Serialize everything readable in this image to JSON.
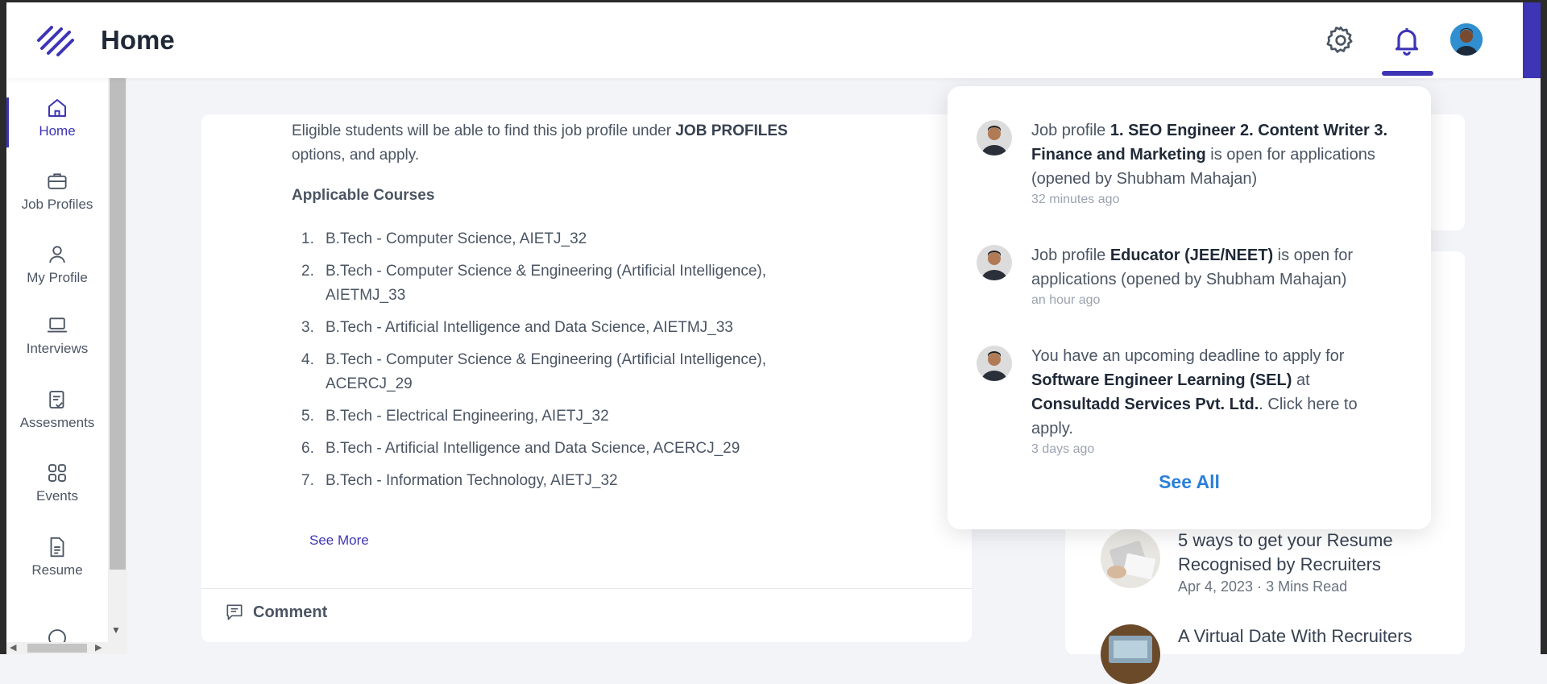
{
  "header": {
    "title": "Home",
    "icons": [
      "logo-icon",
      "gear-icon",
      "bell-icon",
      "avatar"
    ]
  },
  "sidebar": {
    "items": [
      {
        "label": "Home",
        "icon": "home-icon",
        "active": true
      },
      {
        "label": "Job Profiles",
        "icon": "briefcase-icon"
      },
      {
        "label": "My Profile",
        "icon": "user-icon"
      },
      {
        "label": "Interviews",
        "icon": "laptop-icon"
      },
      {
        "label": "Assesments",
        "icon": "clipboard-check-icon"
      },
      {
        "label": "Events",
        "icon": "grid-icon"
      },
      {
        "label": "Resume",
        "icon": "document-icon"
      }
    ]
  },
  "post": {
    "intro_prefix": "Eligible students will be able to find this job profile under ",
    "intro_bold": "JOB PROFILES",
    "intro_suffix": " options, and apply.",
    "courses_heading": "Applicable Courses",
    "courses": [
      {
        "num": "1.",
        "text": "B.Tech - Computer Science, AIETJ_32"
      },
      {
        "num": "2.",
        "text": "B.Tech - Computer Science & Engineering (Artificial Intelligence), AIETMJ_33"
      },
      {
        "num": "3.",
        "text": "B.Tech - Artificial Intelligence and Data Science, AIETMJ_33"
      },
      {
        "num": "4.",
        "text": "B.Tech - Computer Science & Engineering (Artificial Intelligence), ACERCJ_29"
      },
      {
        "num": "5.",
        "text": "B.Tech - Electrical Engineering, AIETJ_32"
      },
      {
        "num": "6.",
        "text": "B.Tech - Artificial Intelligence and Data Science, ACERCJ_29"
      },
      {
        "num": "7.",
        "text": "B.Tech - Information Technology, AIETJ_32"
      }
    ],
    "see_more": "See More",
    "comment": "Comment"
  },
  "blog": {
    "items": [
      {
        "title": "5 ways to get your Resume Recognised by Recruiters",
        "meta": "Apr 4, 2023 · 3 Mins Read"
      },
      {
        "title": "A Virtual Date With Recruiters",
        "meta": ""
      }
    ]
  },
  "notifications": {
    "items": [
      {
        "prefix": "Job profile ",
        "bold": "1. SEO Engineer 2. Content Writer 3. Finance and Marketing",
        "suffix": " is open for applications (opened by Shubham Mahajan)",
        "time": "32 minutes ago"
      },
      {
        "prefix": "Job profile ",
        "bold": "Educator (JEE/NEET)",
        "suffix": " is open for applications (opened by Shubham Mahajan)",
        "time": "an hour ago"
      },
      {
        "prefix": "You have an upcoming deadline to apply for ",
        "bold": "Software Engineer Learning (SEL)",
        "mid": " at ",
        "bold2": "Consultadd Services Pvt. Ltd.",
        "suffix": ". Click here to apply.",
        "time": "3 days ago"
      }
    ],
    "see_all": "See All"
  },
  "colors": {
    "accent": "#3d35b5",
    "link_blue": "#2b7fd8",
    "background": "#f3f4f8"
  }
}
